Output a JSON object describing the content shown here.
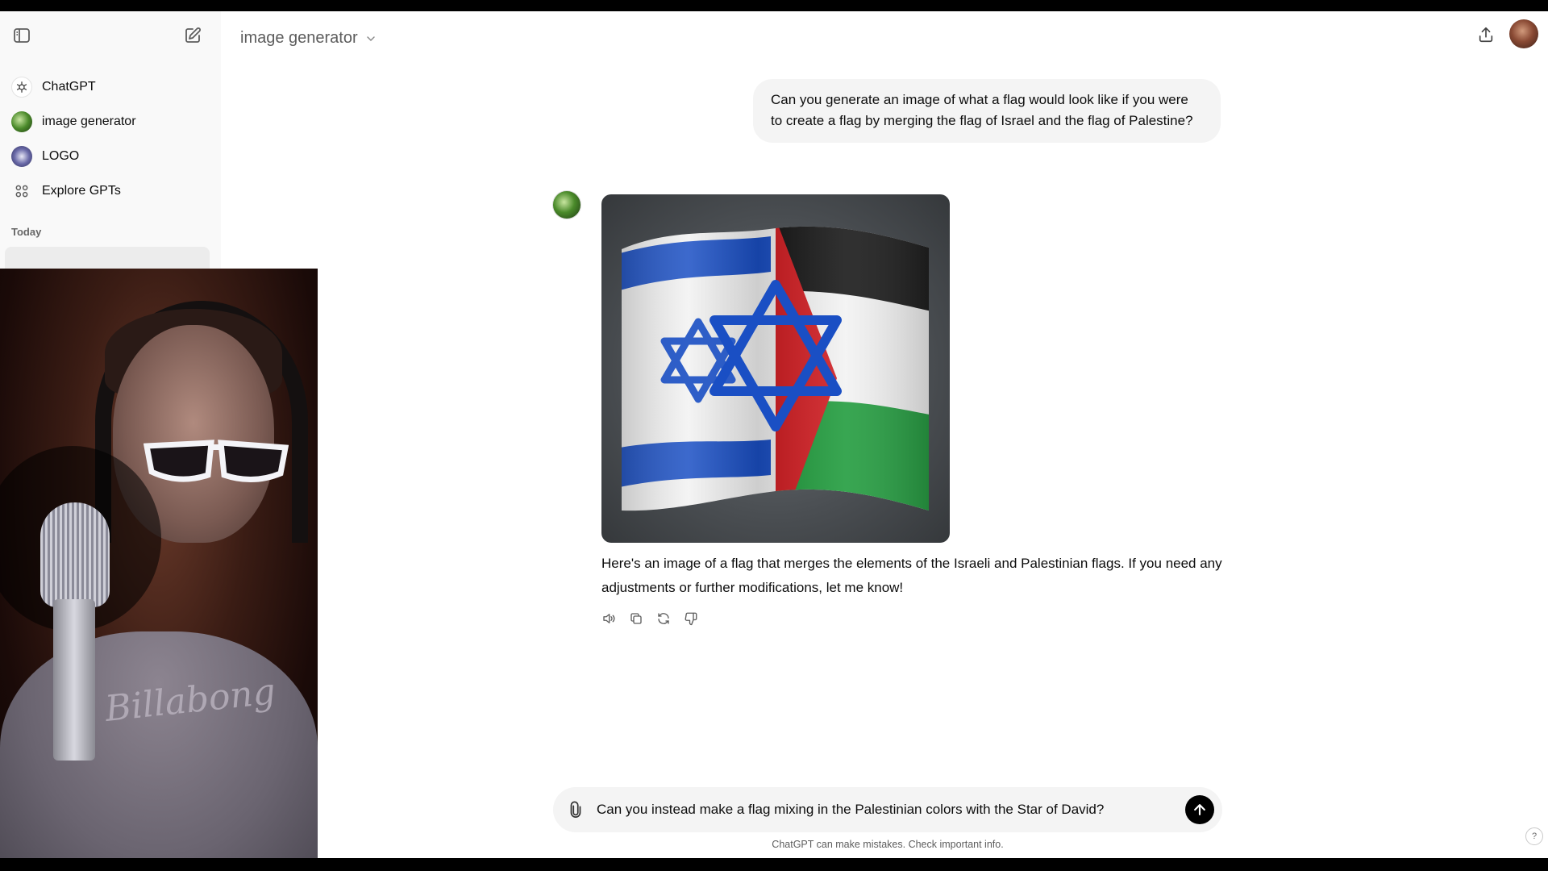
{
  "sidebar": {
    "items": [
      {
        "label": "ChatGPT",
        "icon": "openai-logo-icon"
      },
      {
        "label": "image generator",
        "icon": "gpt-avatar-icon"
      },
      {
        "label": "LOGO",
        "icon": "gpt-avatar-icon"
      },
      {
        "label": "Explore GPTs",
        "icon": "grid-icon"
      }
    ],
    "section_label": "Today"
  },
  "header": {
    "model_name": "image generator"
  },
  "conversation": {
    "user_message": "Can you generate an image of what a flag would look like if you were to create a flag by merging the flag of Israel and the flag of Palestine?",
    "assistant_message": "Here's an image of a flag that merges the elements of the Israeli and Palestinian flags. If you need any adjustments or further modifications, let me know!"
  },
  "composer": {
    "value": "Can you instead make a flag mixing in the Palestinian colors with the Star of David?"
  },
  "footer": {
    "disclaimer": "ChatGPT can make mistakes. Check important info.",
    "help_label": "?"
  },
  "colors": {
    "accent": "#000000",
    "israel_blue": "#1a4fc4",
    "palestine_red": "#d01a1f",
    "palestine_green": "#1d9a3a",
    "palestine_black": "#141414"
  }
}
